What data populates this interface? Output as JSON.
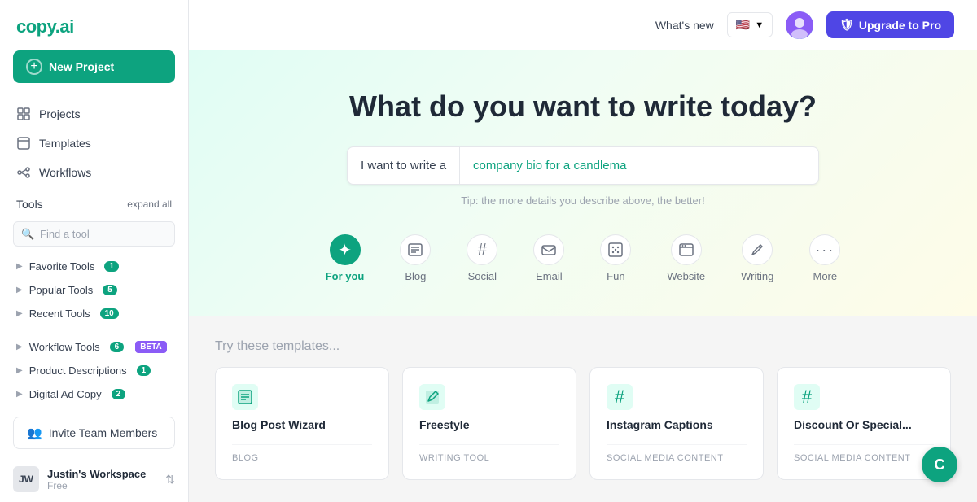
{
  "brand": {
    "name1": "copy",
    "dot": ".",
    "name2": "ai"
  },
  "sidebar": {
    "new_project": "New Project",
    "nav_items": [
      {
        "label": "Projects",
        "icon": "grid"
      },
      {
        "label": "Templates",
        "icon": "template"
      },
      {
        "label": "Workflows",
        "icon": "workflow"
      }
    ],
    "tools_label": "Tools",
    "expand_all": "expand all",
    "search_placeholder": "Find a tool",
    "tool_groups": [
      {
        "label": "Favorite Tools",
        "count": 1
      },
      {
        "label": "Popular Tools",
        "count": 5
      },
      {
        "label": "Recent Tools",
        "count": 10
      }
    ],
    "tool_groups2": [
      {
        "label": "Workflow Tools",
        "count": 6,
        "beta": true
      },
      {
        "label": "Product Descriptions",
        "count": 1
      },
      {
        "label": "Digital Ad Copy",
        "count": 2
      }
    ],
    "invite_label": "Invite Team Members",
    "workspace": {
      "initials": "JW",
      "name": "Justin's Workspace",
      "plan": "Free"
    }
  },
  "topbar": {
    "whats_new": "What's new",
    "lang": "🇺🇸",
    "upgrade_label": "Upgrade to Pro"
  },
  "hero": {
    "title": "What do you want to write today?",
    "write_label": "I want to write a",
    "write_value": "company bio for a candlema",
    "tip": "Tip: the more details you describe above, the better!",
    "categories": [
      {
        "label": "For you",
        "icon": "✦",
        "active": true
      },
      {
        "label": "Blog",
        "icon": "▦"
      },
      {
        "label": "Social",
        "icon": "#"
      },
      {
        "label": "Email",
        "icon": "✉"
      },
      {
        "label": "Fun",
        "icon": "⚄"
      },
      {
        "label": "Website",
        "icon": "⬛"
      },
      {
        "label": "Writing",
        "icon": "📄"
      },
      {
        "label": "More",
        "icon": "···"
      }
    ]
  },
  "templates": {
    "section_title": "Try these templates...",
    "items": [
      {
        "name": "Blog Post Wizard",
        "tag": "BLOG",
        "icon": "▦",
        "type": "blog"
      },
      {
        "name": "Freestyle",
        "tag": "WRITING TOOL",
        "icon": "✎",
        "type": "writing"
      },
      {
        "name": "Instagram Captions",
        "tag": "SOCIAL MEDIA CONTENT",
        "icon": "#",
        "type": "social"
      },
      {
        "name": "Discount Or Special...",
        "tag": "SOCIAL MEDIA CONTENT",
        "icon": "#",
        "type": "social"
      }
    ]
  },
  "chat": {
    "label": "C"
  }
}
